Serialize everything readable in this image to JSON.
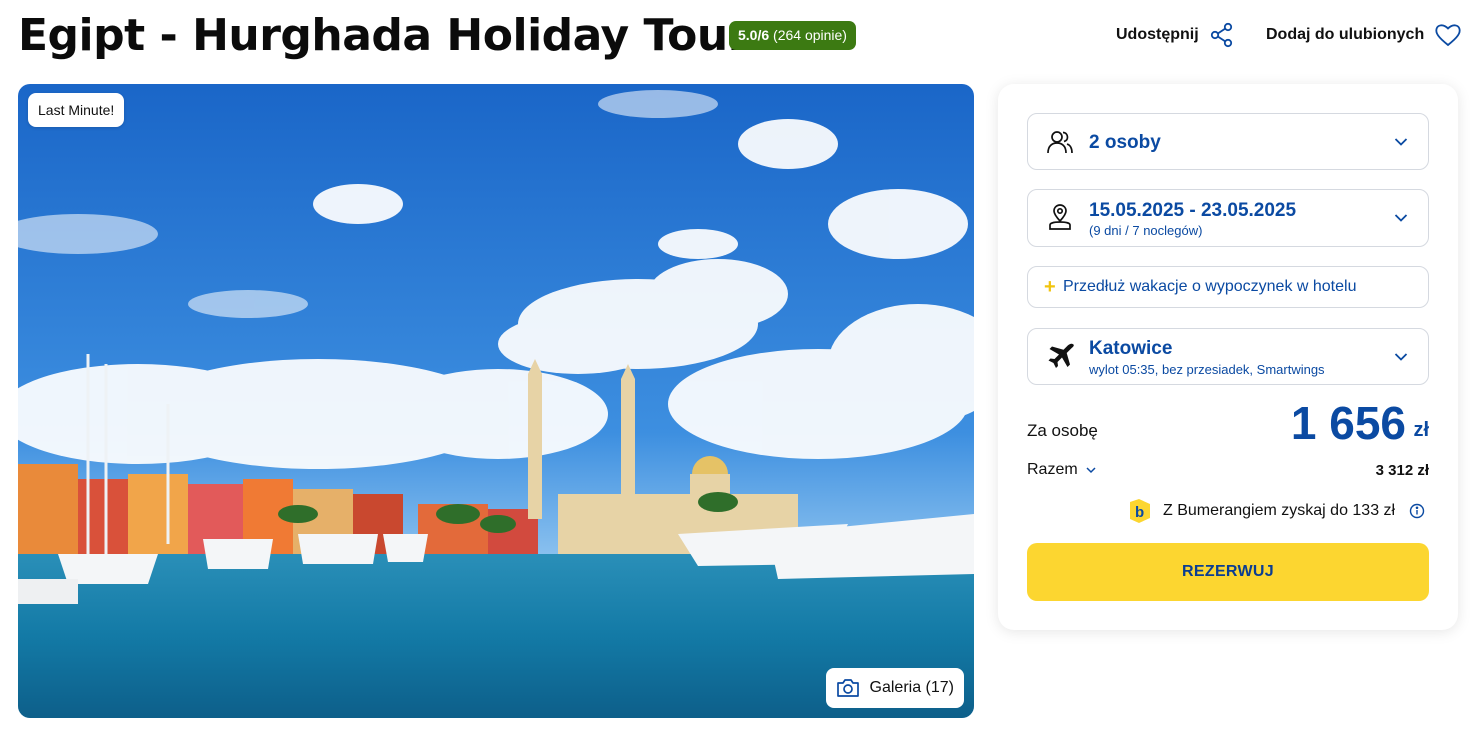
{
  "header": {
    "title": "Egipt - Hurghada Holiday Tour",
    "rating_score": "5.0/6",
    "rating_count": "(264 opinie)",
    "share_label": "Udostępnij",
    "favorite_label": "Dodaj do ulubionych"
  },
  "photo": {
    "badge": "Last Minute!",
    "gallery_label": "Galeria (17)"
  },
  "booking": {
    "persons": "2 osoby",
    "dates": "15.05.2025 - 23.05.2025",
    "duration": "(9 dni / 7 noclegów)",
    "extend_label": "Przedłuż wakacje o wypoczynek w hotelu",
    "departure_city": "Katowice",
    "flight_details": "wylot 05:35, bez przesiadek, Smartwings",
    "per_person_label": "Za osobę",
    "price": "1 656",
    "currency": "zł",
    "total_label": "Razem",
    "total_value": "3 312 zł",
    "bumerang_text": "Z Bumerangiem zyskaj do 133 zł",
    "reserve_label": "REZERWUJ"
  },
  "colors": {
    "brand_blue": "#0b4aa2",
    "rating_green": "#3c7a12",
    "cta_yellow": "#fcd630"
  },
  "icons": [
    "share-icon",
    "heart-icon",
    "camera-icon",
    "persons-icon",
    "location-icon",
    "plane-icon",
    "chevron-down-icon",
    "bumerang-logo-icon",
    "info-icon"
  ]
}
